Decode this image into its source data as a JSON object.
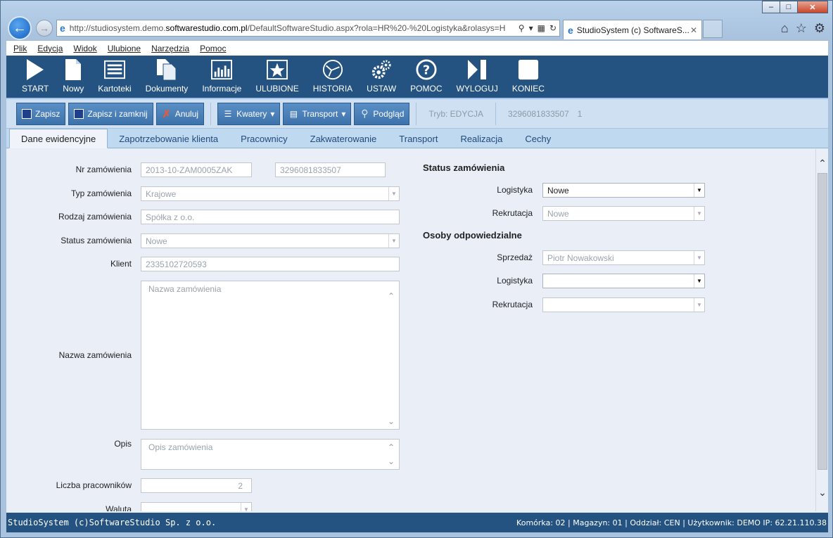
{
  "browser": {
    "url_prefix": "http://studiosystem.demo.",
    "url_domain": "softwarestudio.com.pl",
    "url_rest": "/DefaultSoftwareStudio.aspx?rola=HR%20-%20Logistyka&rolasys=H",
    "tab_title": "StudioSystem (c) SoftwareS..."
  },
  "menubar": [
    "Plik",
    "Edycja",
    "Widok",
    "Ulubione",
    "Narzędzia",
    "Pomoc"
  ],
  "toolbar_top": [
    {
      "label": "START",
      "icon": "start-icon"
    },
    {
      "label": "Nowy",
      "icon": "new-doc-icon"
    },
    {
      "label": "Kartoteki",
      "icon": "cards-icon"
    },
    {
      "label": "Dokumenty",
      "icon": "documents-icon"
    },
    {
      "label": "Informacje",
      "icon": "chart-icon"
    },
    {
      "label": "ULUBIONE",
      "icon": "star-icon"
    },
    {
      "label": "HISTORIA",
      "icon": "history-icon"
    },
    {
      "label": "USTAW",
      "icon": "gears-icon"
    },
    {
      "label": "POMOC",
      "icon": "help-icon"
    },
    {
      "label": "WYLOGUJ",
      "icon": "logout-icon"
    },
    {
      "label": "KONIEC",
      "icon": "end-icon"
    }
  ],
  "toolbar2": {
    "save": "Zapisz",
    "save_close": "Zapisz i zamknij",
    "cancel": "Anuluj",
    "quarters": "Kwatery",
    "transport": "Transport",
    "preview": "Podgląd",
    "mode": "Tryb: EDYCJA",
    "order_id": "3296081833507",
    "count": "1"
  },
  "tabs": [
    "Dane ewidencyjne",
    "Zapotrzebowanie klienta",
    "Pracownicy",
    "Zakwaterowanie",
    "Transport",
    "Realizacja",
    "Cechy"
  ],
  "form": {
    "nr_label": "Nr zamówienia",
    "nr_value": "2013-10-ZAM0005ZAK",
    "nr_value2": "3296081833507",
    "type_label": "Typ zamówienia",
    "type_value": "Krajowe",
    "kind_label": "Rodzaj zamówienia",
    "kind_placeholder": "Spółka z o.o.",
    "status_label": "Status zamówienia",
    "status_value": "Nowe",
    "client_label": "Klient",
    "client_value": "2335102720593",
    "name_label": "Nazwa zamówienia",
    "name_placeholder": "Nazwa zamówienia",
    "desc_label": "Opis",
    "desc_placeholder": "Opis zamówienia",
    "workers_label": "Liczba pracowników",
    "workers_value": "2",
    "currency_label": "Waluta"
  },
  "status_section": {
    "title": "Status zamówienia",
    "logistics_label": "Logistyka",
    "logistics_value": "Nowe",
    "recruit_label": "Rekrutacja",
    "recruit_value": "Nowe"
  },
  "persons_section": {
    "title": "Osoby odpowiedzialne",
    "sales_label": "Sprzedaż",
    "sales_value": "Piotr Nowakowski",
    "logistics_label": "Logistyka",
    "logistics_value": "",
    "recruit_label": "Rekrutacja",
    "recruit_value": ""
  },
  "statusbar": {
    "left": "StudioSystem (c)SoftwareStudio Sp. z o.o.",
    "right": "Komórka: 02 | Magazyn: 01 | Oddział: CEN | Użytkownik: DEMO IP: 62.21.110.38"
  }
}
